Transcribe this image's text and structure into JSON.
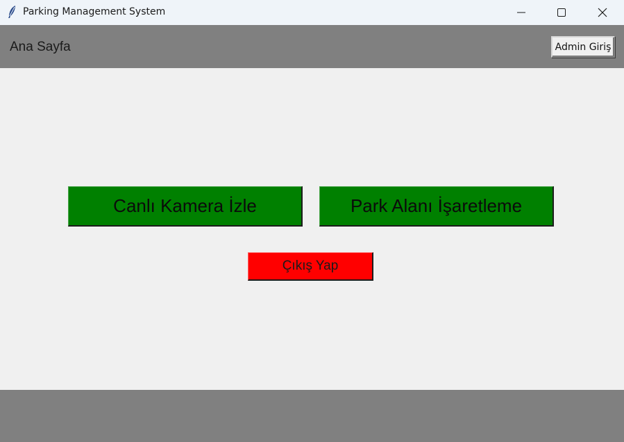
{
  "window": {
    "title": "Parking Management System",
    "icon": "feather-icon",
    "controls": [
      "minimize-icon",
      "maximize-icon",
      "close-icon"
    ]
  },
  "header": {
    "title": "Ana Sayfa",
    "admin_button": "Admin Giriş"
  },
  "main": {
    "camera_button": "Canlı Kamera İzle",
    "park_button": "Park Alanı İşaretleme",
    "exit_button": "Çıkış Yap"
  },
  "colors": {
    "header_bg": "#808080",
    "body_bg": "#f0f0f0",
    "primary_button": "#008000",
    "exit_button": "#ff0000"
  }
}
